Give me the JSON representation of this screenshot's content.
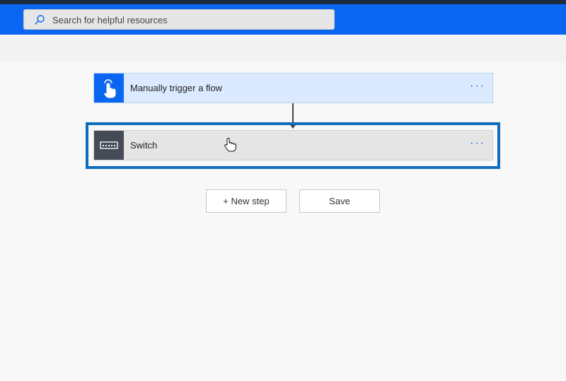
{
  "header": {
    "search_placeholder": "Search for helpful resources"
  },
  "flow": {
    "trigger": {
      "label": "Manually trigger a flow",
      "icon": "hand-touch-icon",
      "more": "···"
    },
    "switch": {
      "label": "Switch",
      "icon": "switch-icon",
      "more": "···"
    }
  },
  "actions": {
    "new_step": "+ New step",
    "save": "Save"
  },
  "colors": {
    "header": "#0a66f0",
    "trigger_card": "#dbeafe",
    "switch_icon_bg": "#444b57",
    "selection_border": "#0f6cbd"
  }
}
